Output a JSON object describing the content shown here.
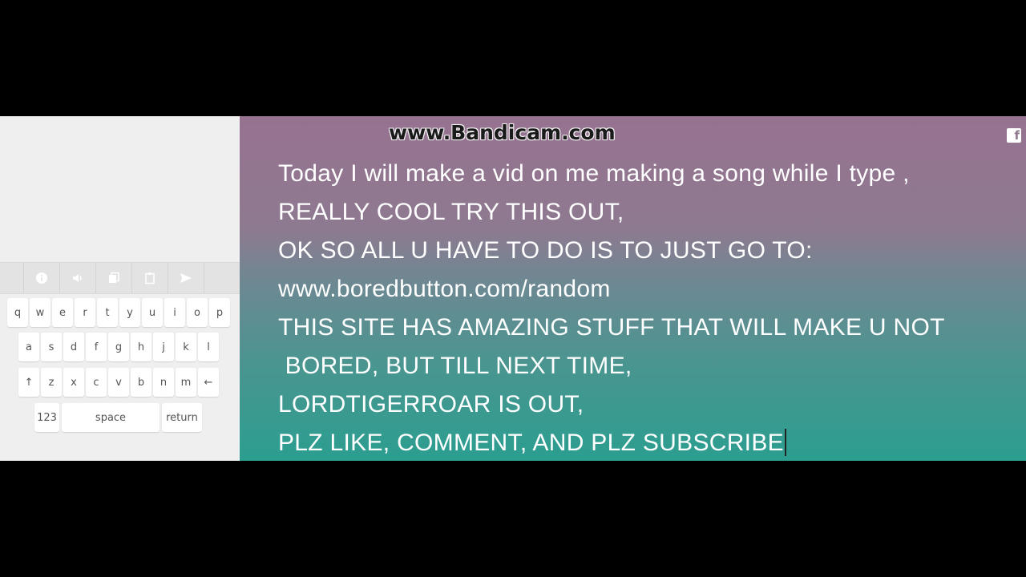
{
  "watermark": "www.Bandicam.com",
  "social": {
    "icon": "facebook-icon",
    "glyph": "f"
  },
  "toolbar": {
    "buttons": [
      {
        "icon": "info-icon"
      },
      {
        "icon": "speaker-icon"
      },
      {
        "icon": "copy-icon"
      },
      {
        "icon": "clipboard-icon"
      },
      {
        "icon": "send-icon"
      }
    ]
  },
  "keyboard": {
    "row1": [
      "q",
      "w",
      "e",
      "r",
      "t",
      "y",
      "u",
      "i",
      "o",
      "p"
    ],
    "row2": [
      "a",
      "s",
      "d",
      "f",
      "g",
      "h",
      "j",
      "k",
      "l"
    ],
    "row3": [
      "↑",
      "z",
      "x",
      "c",
      "v",
      "b",
      "n",
      "m",
      "←"
    ],
    "row4": {
      "num": "123",
      "space": "space",
      "ret": "return"
    }
  },
  "document": {
    "lines": [
      "Today I will make a vid on me making a song while I type ,",
      "REALLY COOL TRY THIS OUT,",
      "OK SO ALL U HAVE TO DO IS TO JUST GO TO:",
      "www.boredbutton.com/random",
      "THIS SITE HAS AMAZING STUFF THAT WILL MAKE U NOT",
      " BORED, BUT TILL NEXT TIME,",
      "LORDTIGERROAR IS OUT,",
      "PLZ LIKE, COMMENT, AND PLZ SUBSCRIBE"
    ]
  },
  "colors": {
    "gradient_top": "#977291",
    "gradient_bottom": "#2b9e90",
    "letterbox": "#000000",
    "panel_bg": "#efefef"
  }
}
